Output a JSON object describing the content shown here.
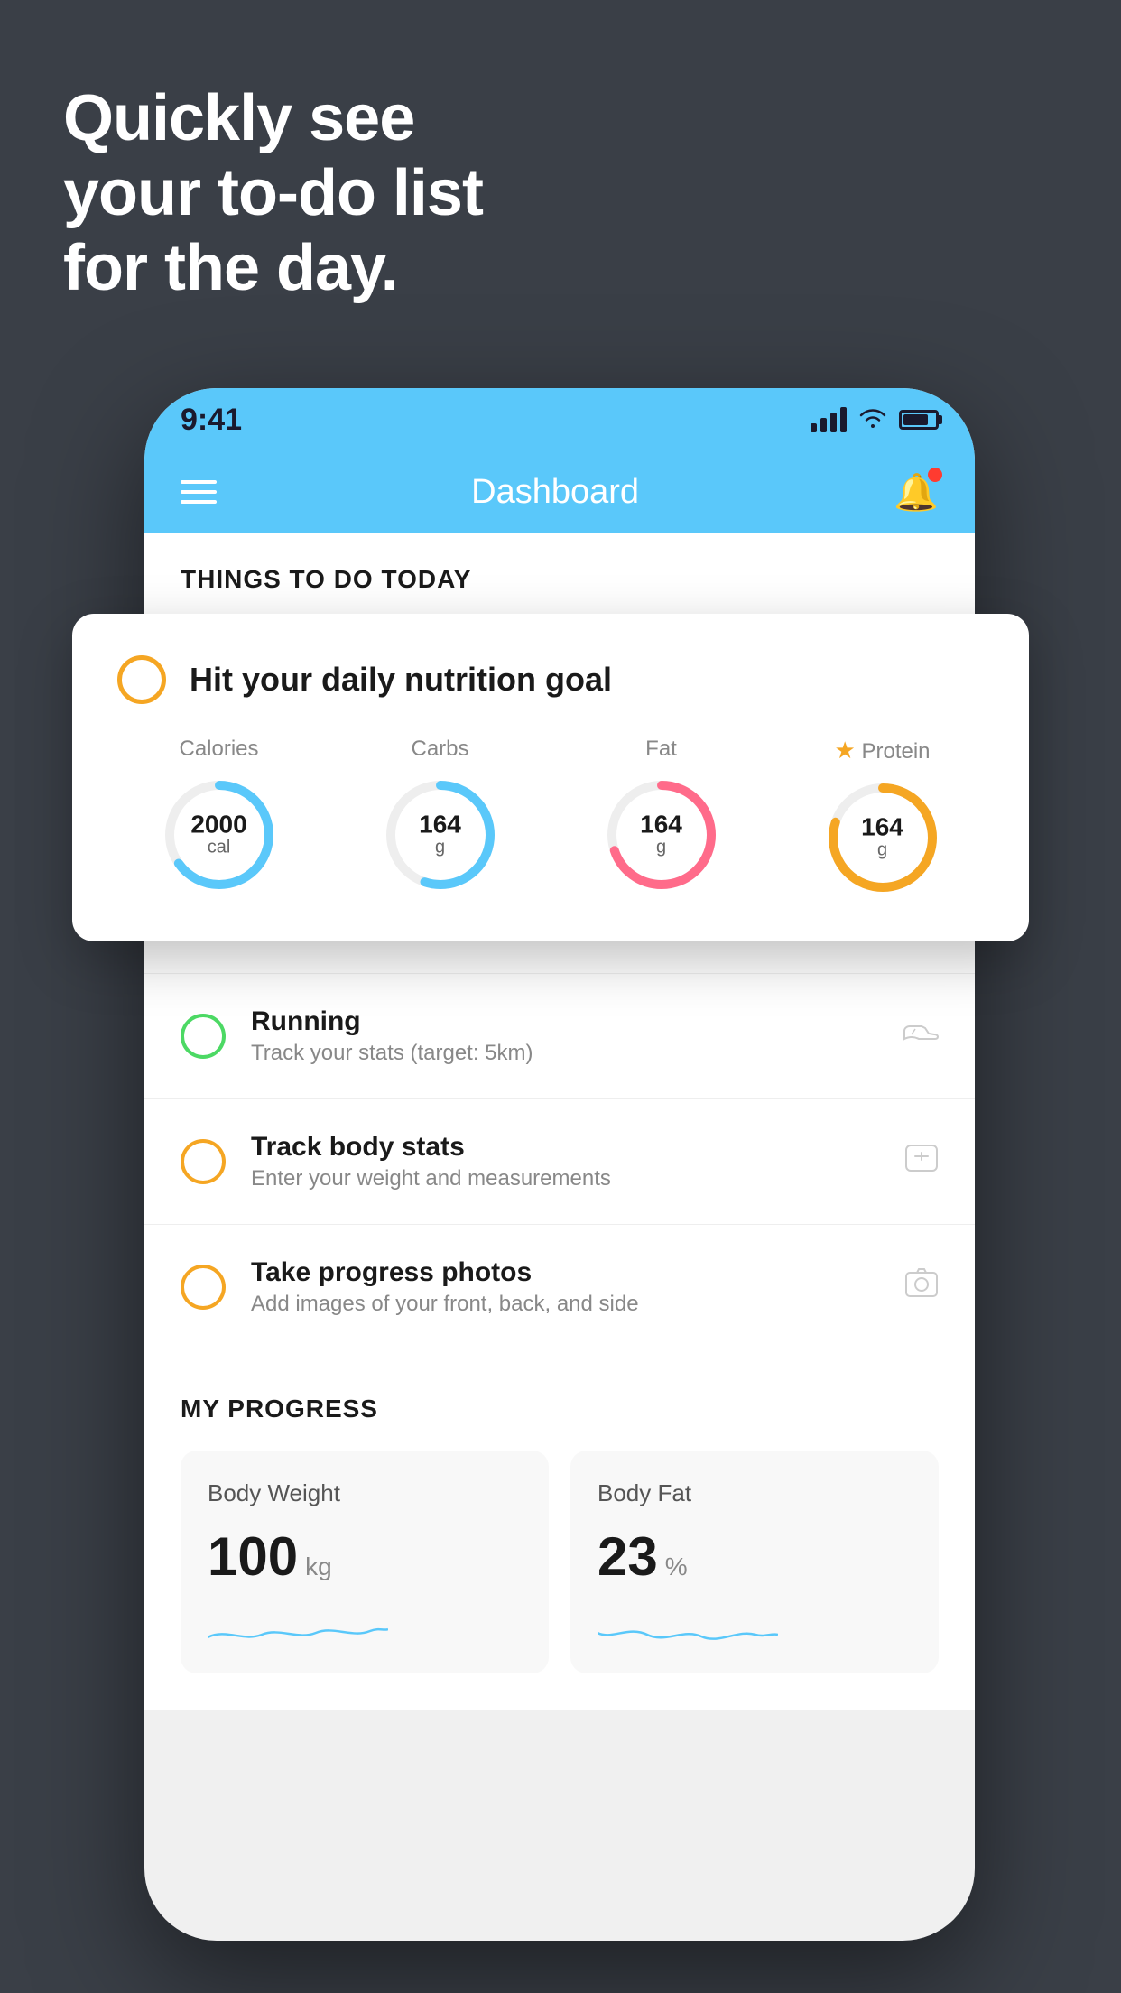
{
  "hero": {
    "line1": "Quickly see",
    "line2": "your to-do list",
    "line3": "for the day."
  },
  "statusBar": {
    "time": "9:41"
  },
  "header": {
    "title": "Dashboard"
  },
  "thingsToDo": {
    "sectionLabel": "THINGS TO DO TODAY"
  },
  "nutritionCard": {
    "title": "Hit your daily nutrition goal",
    "items": [
      {
        "label": "Calories",
        "value": "2000",
        "unit": "cal",
        "color": "#5ac8fa",
        "percent": 65
      },
      {
        "label": "Carbs",
        "value": "164",
        "unit": "g",
        "color": "#5ac8fa",
        "percent": 55
      },
      {
        "label": "Fat",
        "value": "164",
        "unit": "g",
        "color": "#ff6b8a",
        "percent": 70
      },
      {
        "label": "Protein",
        "value": "164",
        "unit": "g",
        "color": "#f5a623",
        "percent": 80,
        "starred": true
      }
    ]
  },
  "todoItems": [
    {
      "title": "Running",
      "subtitle": "Track your stats (target: 5km)",
      "circleColor": "green",
      "icon": "shoe"
    },
    {
      "title": "Track body stats",
      "subtitle": "Enter your weight and measurements",
      "circleColor": "yellow",
      "icon": "scale"
    },
    {
      "title": "Take progress photos",
      "subtitle": "Add images of your front, back, and side",
      "circleColor": "yellow",
      "icon": "photo"
    }
  ],
  "progress": {
    "sectionLabel": "MY PROGRESS",
    "cards": [
      {
        "title": "Body Weight",
        "value": "100",
        "unit": "kg"
      },
      {
        "title": "Body Fat",
        "value": "23",
        "unit": "%"
      }
    ]
  }
}
